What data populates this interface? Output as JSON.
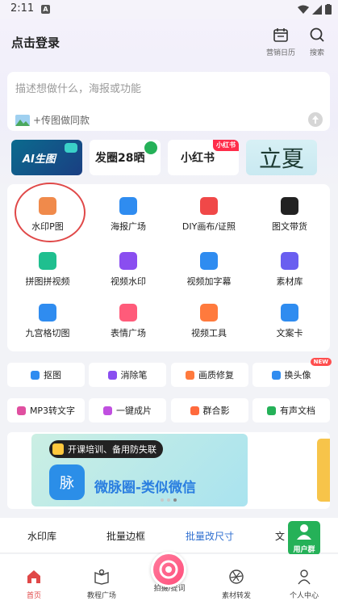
{
  "status_bar": {
    "time": "2:11",
    "notif_icon": "A"
  },
  "header": {
    "login": "点击登录",
    "calendar_label": "营销日历",
    "search_label": "搜索"
  },
  "search_box": {
    "placeholder": "描述想做什么，海报或功能",
    "image_hint": "+传图做同款"
  },
  "banners": [
    {
      "text": "AI生图"
    },
    {
      "text": "发圈28晒"
    },
    {
      "text": "小红书",
      "tag": "小红书"
    },
    {
      "text": "立夏"
    }
  ],
  "feature_grid": [
    {
      "label": "水印P图",
      "icon": "watermark-icon",
      "color": "#f08a4b"
    },
    {
      "label": "海报广场",
      "icon": "poster-icon",
      "color": "#2f8cf0"
    },
    {
      "label": "DIY画布/证照",
      "icon": "canvas-icon",
      "color": "#f04848"
    },
    {
      "label": "图文带货",
      "icon": "tiktok-icon",
      "color": "#222222"
    },
    {
      "label": "拼图拼视频",
      "icon": "collage-icon",
      "color": "#1fbf8f"
    },
    {
      "label": "视频水印",
      "icon": "video-watermark-icon",
      "color": "#8a4ef0"
    },
    {
      "label": "视频加字幕",
      "icon": "subtitle-icon",
      "color": "#2f8cf0"
    },
    {
      "label": "素材库",
      "icon": "layers-icon",
      "color": "#6a5ef0"
    },
    {
      "label": "九宫格切图",
      "icon": "grid-icon",
      "color": "#2f8cf0"
    },
    {
      "label": "表情广场",
      "icon": "emoji-icon",
      "color": "#ff5b7a"
    },
    {
      "label": "视频工具",
      "icon": "video-tool-icon",
      "color": "#ff7a3d"
    },
    {
      "label": "文案卡",
      "icon": "text-card-icon",
      "color": "#2f8cf0"
    }
  ],
  "tools": [
    {
      "label": "抠图",
      "color": "#2f8cf0"
    },
    {
      "label": "消除笔",
      "color": "#8a4ef0"
    },
    {
      "label": "画质修复",
      "color": "#ff7a3d"
    },
    {
      "label": "换头像",
      "color": "#2f8cf0",
      "badge": "NEW"
    },
    {
      "label": "MP3转文字",
      "color": "#e04fa0"
    },
    {
      "label": "一键成片",
      "color": "#c04fe0"
    },
    {
      "label": "群合影",
      "color": "#ff6a3d"
    },
    {
      "label": "有声文档",
      "color": "#25b158"
    }
  ],
  "promo": {
    "chip": "开课培训、备用防失联",
    "logo": "脉",
    "title": "微脉圈-类似微信"
  },
  "bottom_tabs": [
    "水印库",
    "批量边框",
    "批量改尺寸",
    "文"
  ],
  "user_group": "用户群",
  "nav": {
    "home": "首页",
    "tutorial": "教程广场",
    "camera": "拍摄/提词",
    "material": "素材转发",
    "profile": "个人中心"
  },
  "colors": {
    "accent": "#e04848",
    "nav_active": "#e04848"
  }
}
